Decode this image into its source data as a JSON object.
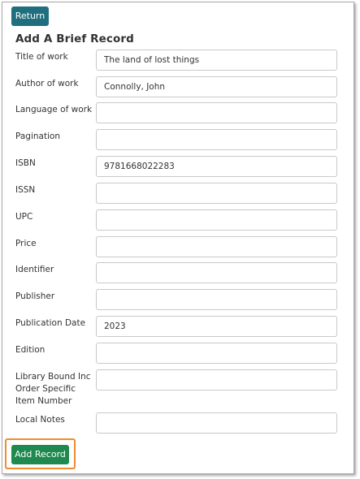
{
  "toolbar": {
    "return_label": "Return"
  },
  "form": {
    "title": "Add A Brief Record",
    "fields": [
      {
        "label": "Title of work",
        "value": "The land of lost things"
      },
      {
        "label": "Author of work",
        "value": "Connolly, John"
      },
      {
        "label": "Language of work",
        "value": ""
      },
      {
        "label": "Pagination",
        "value": ""
      },
      {
        "label": "ISBN",
        "value": "9781668022283"
      },
      {
        "label": "ISSN",
        "value": ""
      },
      {
        "label": "UPC",
        "value": ""
      },
      {
        "label": "Price",
        "value": ""
      },
      {
        "label": "Identifier",
        "value": ""
      },
      {
        "label": "Publisher",
        "value": ""
      },
      {
        "label": "Publication Date",
        "value": "2023"
      },
      {
        "label": "Edition",
        "value": ""
      },
      {
        "label": "Library Bound Inc Order Specific Item Number",
        "value": ""
      },
      {
        "label": "Local Notes",
        "value": ""
      }
    ],
    "submit_label": "Add Record"
  },
  "colors": {
    "return_button": "#1f6f7f",
    "add_button": "#1e8a4f",
    "highlight": "#f08c2e"
  }
}
